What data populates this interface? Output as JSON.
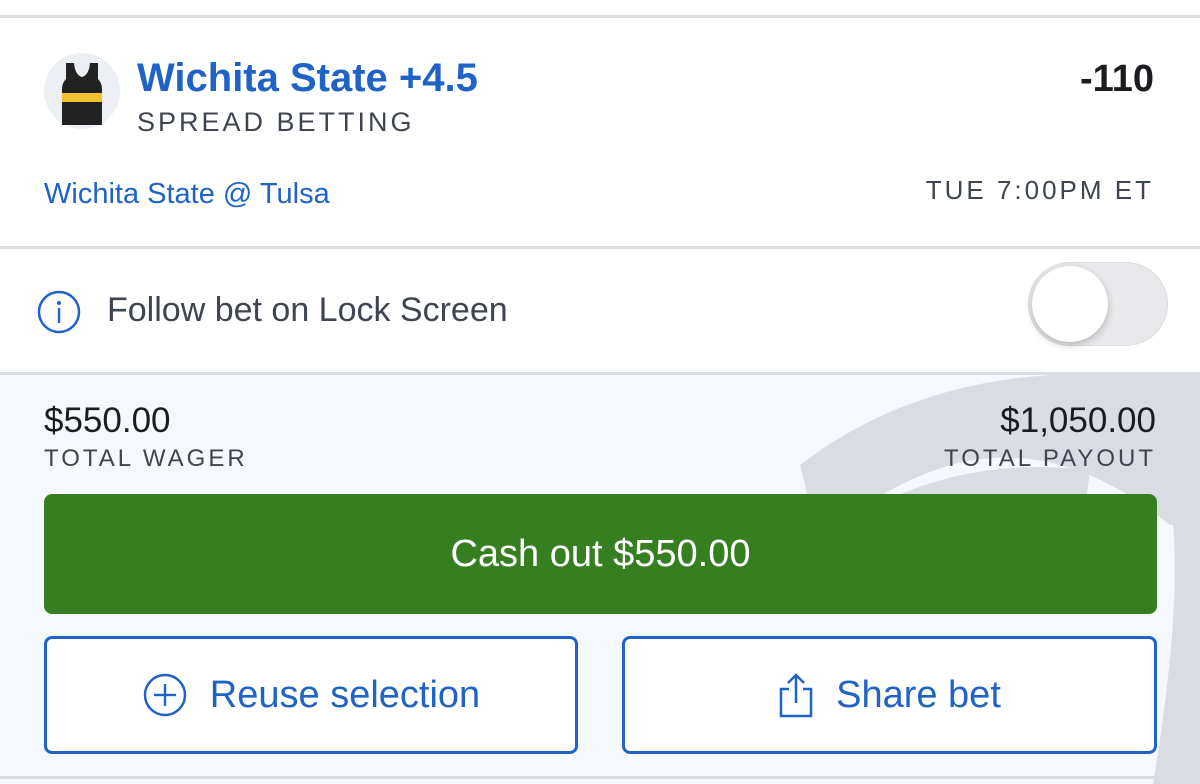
{
  "bet": {
    "selection": "Wichita State +4.5",
    "market": "SPREAD BETTING",
    "odds": "-110",
    "event": "Wichita State @ Tulsa",
    "time": "TUE 7:00PM ET",
    "jersey_icon": "basketball-jersey-icon",
    "jersey_colors": {
      "body": "#222222",
      "stripe": "#f2c230"
    }
  },
  "follow": {
    "label": "Follow bet on Lock Screen",
    "toggle_on": false,
    "icon": "info-icon"
  },
  "summary": {
    "wager_value": "$550.00",
    "wager_label": "TOTAL WAGER",
    "payout_value": "$1,050.00",
    "payout_label": "TOTAL PAYOUT"
  },
  "actions": {
    "cashout_label": "Cash out $550.00",
    "reuse_label": "Reuse selection",
    "reuse_icon": "plus-circle-icon",
    "share_label": "Share bet",
    "share_icon": "share-icon"
  },
  "colors": {
    "accent": "#1f63c6",
    "cashout": "#367f21",
    "panel_bg": "#f5f8fc"
  }
}
